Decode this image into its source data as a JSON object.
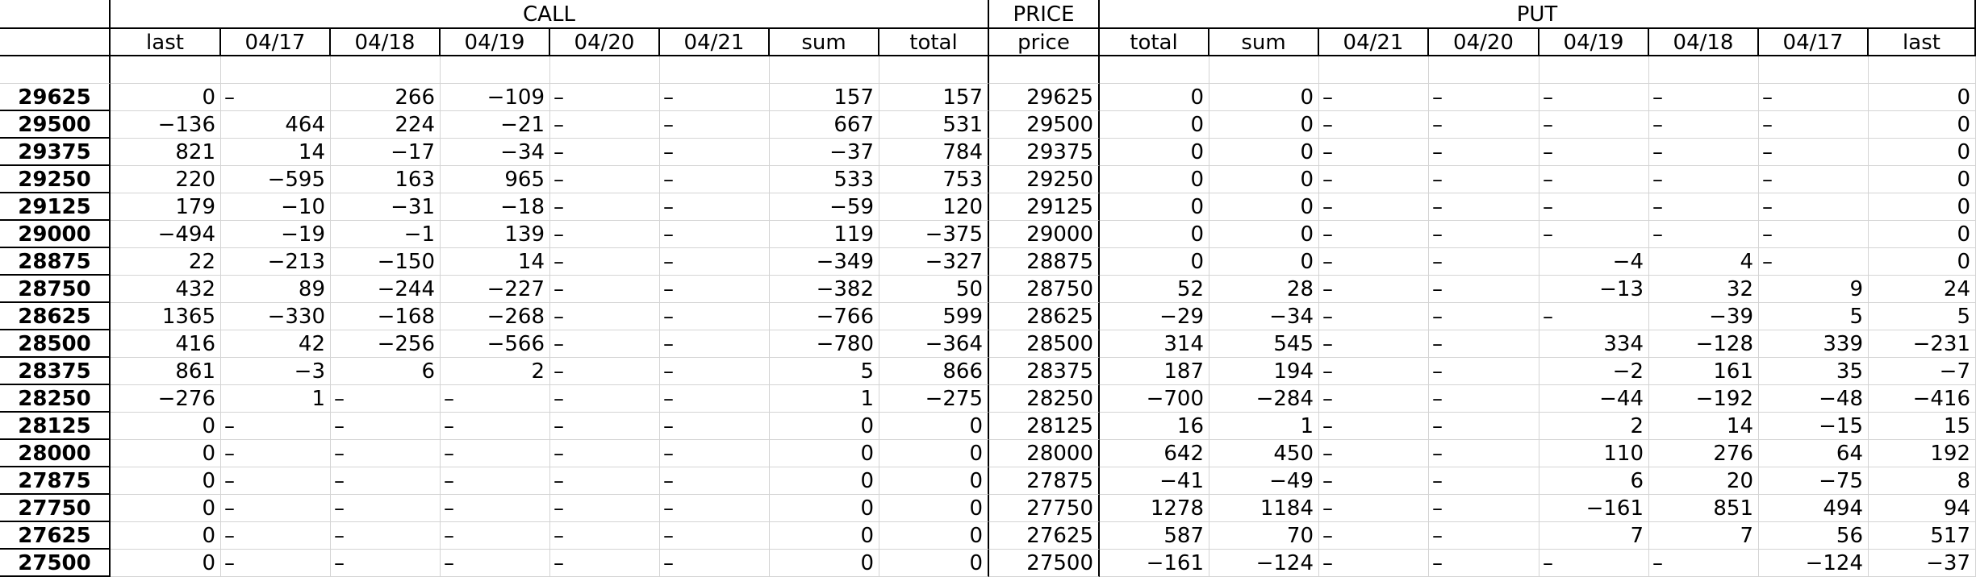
{
  "groups": {
    "call": "CALL",
    "price": "PRICE",
    "put": "PUT"
  },
  "headers": [
    "",
    "last",
    "04/17",
    "04/18",
    "04/19",
    "04/20",
    "04/21",
    "sum",
    "total",
    "price",
    "total",
    "sum",
    "04/21",
    "04/20",
    "04/19",
    "04/18",
    "04/17",
    "last"
  ],
  "rows": [
    [
      "29625",
      "0",
      "–",
      "266",
      "−109",
      "–",
      "–",
      "157",
      "157",
      "29625",
      "0",
      "0",
      "–",
      "–",
      "–",
      "–",
      "–",
      "0"
    ],
    [
      "29500",
      "−136",
      "464",
      "224",
      "−21",
      "–",
      "–",
      "667",
      "531",
      "29500",
      "0",
      "0",
      "–",
      "–",
      "–",
      "–",
      "–",
      "0"
    ],
    [
      "29375",
      "821",
      "14",
      "−17",
      "−34",
      "–",
      "–",
      "−37",
      "784",
      "29375",
      "0",
      "0",
      "–",
      "–",
      "–",
      "–",
      "–",
      "0"
    ],
    [
      "29250",
      "220",
      "−595",
      "163",
      "965",
      "–",
      "–",
      "533",
      "753",
      "29250",
      "0",
      "0",
      "–",
      "–",
      "–",
      "–",
      "–",
      "0"
    ],
    [
      "29125",
      "179",
      "−10",
      "−31",
      "−18",
      "–",
      "–",
      "−59",
      "120",
      "29125",
      "0",
      "0",
      "–",
      "–",
      "–",
      "–",
      "–",
      "0"
    ],
    [
      "29000",
      "−494",
      "−19",
      "−1",
      "139",
      "–",
      "–",
      "119",
      "−375",
      "29000",
      "0",
      "0",
      "–",
      "–",
      "–",
      "–",
      "–",
      "0"
    ],
    [
      "28875",
      "22",
      "−213",
      "−150",
      "14",
      "–",
      "–",
      "−349",
      "−327",
      "28875",
      "0",
      "0",
      "–",
      "–",
      "−4",
      "4",
      "–",
      "0"
    ],
    [
      "28750",
      "432",
      "89",
      "−244",
      "−227",
      "–",
      "–",
      "−382",
      "50",
      "28750",
      "52",
      "28",
      "–",
      "–",
      "−13",
      "32",
      "9",
      "24"
    ],
    [
      "28625",
      "1365",
      "−330",
      "−168",
      "−268",
      "–",
      "–",
      "−766",
      "599",
      "28625",
      "−29",
      "−34",
      "–",
      "–",
      "–",
      "−39",
      "5",
      "5"
    ],
    [
      "28500",
      "416",
      "42",
      "−256",
      "−566",
      "–",
      "–",
      "−780",
      "−364",
      "28500",
      "314",
      "545",
      "–",
      "–",
      "334",
      "−128",
      "339",
      "−231"
    ],
    [
      "28375",
      "861",
      "−3",
      "6",
      "2",
      "–",
      "–",
      "5",
      "866",
      "28375",
      "187",
      "194",
      "–",
      "–",
      "−2",
      "161",
      "35",
      "−7"
    ],
    [
      "28250",
      "−276",
      "1",
      "–",
      "–",
      "–",
      "–",
      "1",
      "−275",
      "28250",
      "−700",
      "−284",
      "–",
      "–",
      "−44",
      "−192",
      "−48",
      "−416"
    ],
    [
      "28125",
      "0",
      "–",
      "–",
      "–",
      "–",
      "–",
      "0",
      "0",
      "28125",
      "16",
      "1",
      "–",
      "–",
      "2",
      "14",
      "−15",
      "15"
    ],
    [
      "28000",
      "0",
      "–",
      "–",
      "–",
      "–",
      "–",
      "0",
      "0",
      "28000",
      "642",
      "450",
      "–",
      "–",
      "110",
      "276",
      "64",
      "192"
    ],
    [
      "27875",
      "0",
      "–",
      "–",
      "–",
      "–",
      "–",
      "0",
      "0",
      "27875",
      "−41",
      "−49",
      "–",
      "–",
      "6",
      "20",
      "−75",
      "8"
    ],
    [
      "27750",
      "0",
      "–",
      "–",
      "–",
      "–",
      "–",
      "0",
      "0",
      "27750",
      "1278",
      "1184",
      "–",
      "–",
      "−161",
      "851",
      "494",
      "94"
    ],
    [
      "27625",
      "0",
      "–",
      "–",
      "–",
      "–",
      "–",
      "0",
      "0",
      "27625",
      "587",
      "70",
      "–",
      "–",
      "7",
      "7",
      "56",
      "517"
    ],
    [
      "27500",
      "0",
      "–",
      "–",
      "–",
      "–",
      "–",
      "0",
      "0",
      "27500",
      "−161",
      "−124",
      "–",
      "–",
      "–",
      "–",
      "−124",
      "−37"
    ]
  ]
}
